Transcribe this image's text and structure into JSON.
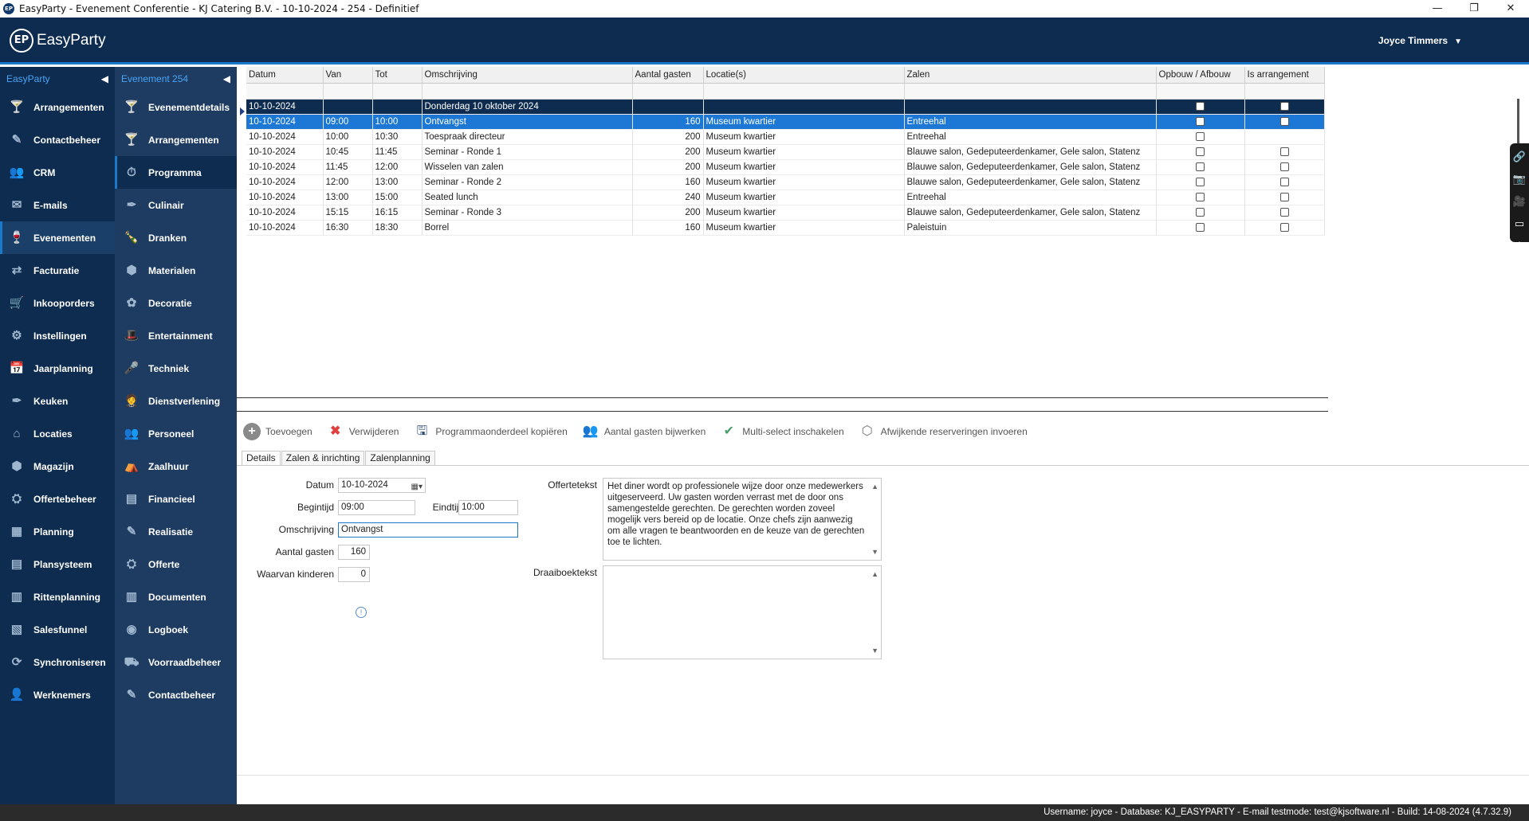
{
  "window": {
    "title": "EasyParty - Evenement Conferentie - KJ Catering B.V. - 10-10-2024 - 254 - Definitief",
    "icon": "EP",
    "minimize": "—",
    "maximize": "❐",
    "close": "✕"
  },
  "header": {
    "logo_mark": "EP",
    "logo_text": "EasyParty",
    "user": "Joyce Timmers",
    "user_caret": "▼"
  },
  "sidebar1": {
    "heading": "EasyParty",
    "collapse": "◀",
    "items": [
      {
        "label": "Arrangementen",
        "icon": "🍸"
      },
      {
        "label": "Contactbeheer",
        "icon": "✎"
      },
      {
        "label": "CRM",
        "icon": "👥"
      },
      {
        "label": "E-mails",
        "icon": "✉"
      },
      {
        "label": "Evenementen",
        "icon": "🍷"
      },
      {
        "label": "Facturatie",
        "icon": "⇄"
      },
      {
        "label": "Inkooporders",
        "icon": "🛒"
      },
      {
        "label": "Instellingen",
        "icon": "⚙"
      },
      {
        "label": "Jaarplanning",
        "icon": "📅"
      },
      {
        "label": "Keuken",
        "icon": "✒"
      },
      {
        "label": "Locaties",
        "icon": "⌂"
      },
      {
        "label": "Magazijn",
        "icon": "⬢"
      },
      {
        "label": "Offertebeheer",
        "icon": "⛭"
      },
      {
        "label": "Planning",
        "icon": "▦"
      },
      {
        "label": "Plansysteem",
        "icon": "▤"
      },
      {
        "label": "Rittenplanning",
        "icon": "▥"
      },
      {
        "label": "Salesfunnel",
        "icon": "▧"
      },
      {
        "label": "Synchroniseren",
        "icon": "⟳"
      },
      {
        "label": "Werknemers",
        "icon": "👤"
      }
    ]
  },
  "sidebar2": {
    "heading": "Evenement 254",
    "collapse": "◀",
    "items": [
      {
        "label": "Evenementdetails",
        "icon": "🍸"
      },
      {
        "label": "Arrangementen",
        "icon": "🍸"
      },
      {
        "label": "Programma",
        "icon": "⏱"
      },
      {
        "label": "Culinair",
        "icon": "✒"
      },
      {
        "label": "Dranken",
        "icon": "🍾"
      },
      {
        "label": "Materialen",
        "icon": "⬢"
      },
      {
        "label": "Decoratie",
        "icon": "✿"
      },
      {
        "label": "Entertainment",
        "icon": "🎩"
      },
      {
        "label": "Techniek",
        "icon": "🎤"
      },
      {
        "label": "Dienstverlening",
        "icon": "🤵"
      },
      {
        "label": "Personeel",
        "icon": "👥"
      },
      {
        "label": "Zaalhuur",
        "icon": "⛺"
      },
      {
        "label": "Financieel",
        "icon": "▤"
      },
      {
        "label": "Realisatie",
        "icon": "✎"
      },
      {
        "label": "Offerte",
        "icon": "⛭"
      },
      {
        "label": "Documenten",
        "icon": "▥"
      },
      {
        "label": "Logboek",
        "icon": "◉"
      },
      {
        "label": "Voorraadbeheer",
        "icon": "⛟"
      },
      {
        "label": "Contactbeheer",
        "icon": "✎"
      }
    ]
  },
  "grid": {
    "columns": [
      "Datum",
      "Van",
      "Tot",
      "Omschrijving",
      "Aantal gasten",
      "Locatie(s)",
      "Zalen",
      "Opbouw / Afbouw",
      "Is arrangement"
    ],
    "group_row": {
      "datum": "10-10-2024",
      "omschrijving": "Donderdag 10 oktober 2024"
    },
    "rows": [
      {
        "datum": "10-10-2024",
        "van": "09:00",
        "tot": "10:00",
        "omschrijving": "Ontvangst",
        "gasten": "160",
        "locatie": "Museum kwartier",
        "zalen": "Entreehal",
        "arr": true
      },
      {
        "datum": "10-10-2024",
        "van": "10:00",
        "tot": "10:30",
        "omschrijving": "Toespraak directeur",
        "gasten": "200",
        "locatie": "Museum kwartier",
        "zalen": "Entreehal",
        "arr": false
      },
      {
        "datum": "10-10-2024",
        "van": "10:45",
        "tot": "11:45",
        "omschrijving": "Seminar - Ronde 1",
        "gasten": "200",
        "locatie": "Museum kwartier",
        "zalen": "Blauwe salon, Gedeputeerdenkamer, Gele salon, Statenz",
        "arr": true
      },
      {
        "datum": "10-10-2024",
        "van": "11:45",
        "tot": "12:00",
        "omschrijving": "Wisselen van zalen",
        "gasten": "200",
        "locatie": "Museum kwartier",
        "zalen": "Blauwe salon, Gedeputeerdenkamer, Gele salon, Statenz",
        "arr": true
      },
      {
        "datum": "10-10-2024",
        "van": "12:00",
        "tot": "13:00",
        "omschrijving": "Seminar - Ronde 2",
        "gasten": "160",
        "locatie": "Museum kwartier",
        "zalen": "Blauwe salon, Gedeputeerdenkamer, Gele salon, Statenz",
        "arr": true
      },
      {
        "datum": "10-10-2024",
        "van": "13:00",
        "tot": "15:00",
        "omschrijving": "Seated lunch",
        "gasten": "240",
        "locatie": "Museum kwartier",
        "zalen": "Entreehal",
        "arr": true
      },
      {
        "datum": "10-10-2024",
        "van": "15:15",
        "tot": "16:15",
        "omschrijving": "Seminar - Ronde 3",
        "gasten": "200",
        "locatie": "Museum kwartier",
        "zalen": "Blauwe salon, Gedeputeerdenkamer, Gele salon, Statenz",
        "arr": true
      },
      {
        "datum": "10-10-2024",
        "van": "16:30",
        "tot": "18:30",
        "omschrijving": "Borrel",
        "gasten": "160",
        "locatie": "Museum kwartier",
        "zalen": "Paleistuin",
        "arr": true
      }
    ]
  },
  "floatbar": [
    "🔗",
    "📷",
    "🎥",
    "▭",
    "⚙"
  ],
  "toolbar": {
    "add": "Toevoegen",
    "delete": "Verwijderen",
    "copy": "Programmaonderdeel kopiëren",
    "guests": "Aantal gasten bijwerken",
    "multiselect": "Multi-select inschakelen",
    "reservations": "Afwijkende reserveringen invoeren"
  },
  "tabs": [
    "Details",
    "Zalen & inrichting",
    "Zalenplanning"
  ],
  "form": {
    "datum_label": "Datum",
    "datum_value": "10-10-2024",
    "begintijd_label": "Begintijd",
    "begintijd_value": "09:00",
    "eindtijd_label": "Eindtijd",
    "eindtijd_value": "10:00",
    "omschrijving_label": "Omschrijving",
    "omschrijving_value": "Ontvangst",
    "gasten_label": "Aantal gasten",
    "gasten_value": "160",
    "kinderen_label": "Waarvan kinderen",
    "kinderen_value": "0",
    "offertetekst_label": "Offertetekst",
    "offertetekst_value": "Het diner wordt op professionele wijze door onze medewerkers uitgeserveerd. Uw gasten worden verrast met de door ons samengestelde gerechten. De gerechten worden zoveel mogelijk vers bereid op de locatie. Onze chefs zijn aanwezig om alle vragen te beantwoorden en de keuze van de gerechten toe te lichten.",
    "draaiboektekst_label": "Draaiboektekst",
    "draaiboektekst_value": ""
  },
  "statusbar": "Username: joyce - Database: KJ_EASYPARTY - E-mail testmode: test@kjsoftware.nl - Build: 14-08-2024 (4.7.32.9)",
  "colors": {
    "nav_dark": "#0d2c4f",
    "nav_mid": "#1e3c62",
    "accent": "#1c78c8",
    "selected_row": "#1c78d4"
  }
}
